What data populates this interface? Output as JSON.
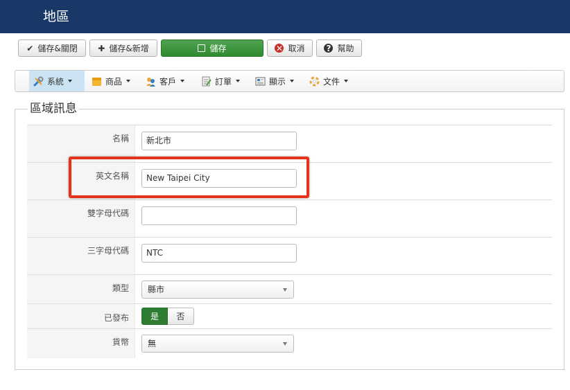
{
  "header": {
    "title": "地區"
  },
  "toolbar": {
    "save_close": "儲存&關閉",
    "save_new": "儲存&新增",
    "save": "儲存",
    "cancel": "取消",
    "help": "幫助"
  },
  "menu": {
    "items": [
      {
        "label": "系統",
        "icon": "tools-icon"
      },
      {
        "label": "商品",
        "icon": "product-icon"
      },
      {
        "label": "客戶",
        "icon": "customer-icon"
      },
      {
        "label": "訂單",
        "icon": "order-icon"
      },
      {
        "label": "顯示",
        "icon": "display-icon"
      },
      {
        "label": "文件",
        "icon": "document-icon"
      }
    ]
  },
  "form": {
    "legend": "區域訊息",
    "name_label": "名稱",
    "name_value": "新北市",
    "english_name_label": "英文名稱",
    "english_name_value": "New Taipei City",
    "two_letter_label": "雙字母代碼",
    "two_letter_value": "",
    "three_letter_label": "三字母代碼",
    "three_letter_value": "NTC",
    "type_label": "類型",
    "type_value": "縣市",
    "published_label": "已發布",
    "published_yes": "是",
    "published_no": "否",
    "currency_label": "貨幣",
    "currency_value": "無"
  },
  "colors": {
    "header_bg": "#1a3867",
    "save_button": "#3d973d",
    "highlight_border": "#e5331b",
    "published_active": "#2f7d32"
  }
}
